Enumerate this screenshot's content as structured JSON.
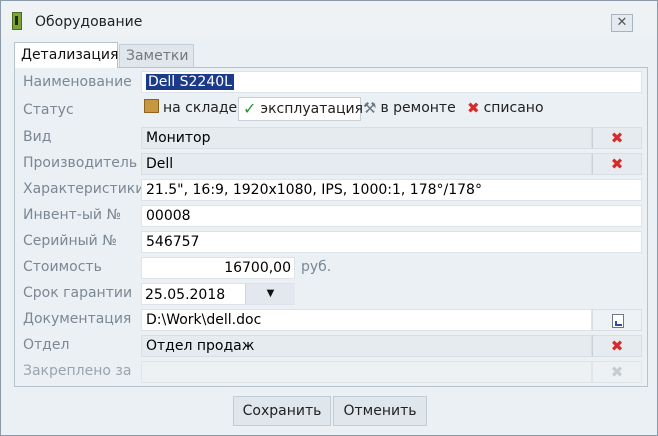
{
  "window": {
    "title": "Оборудование",
    "close_symbol": "✕"
  },
  "tabs": [
    {
      "label": "Детализация",
      "active": true
    },
    {
      "label": "Заметки",
      "active": false
    }
  ],
  "fields": {
    "name": {
      "label": "Наименование",
      "value": "Dell S2240L"
    },
    "status": {
      "label": "Статус",
      "options": [
        {
          "label": "на складе",
          "icon": "box-icon"
        },
        {
          "label": "эксплуатация",
          "icon": "check-icon"
        },
        {
          "label": "в ремонте",
          "icon": "tools-icon"
        },
        {
          "label": "списано",
          "icon": "x-icon"
        }
      ],
      "selected": "эксплуатация"
    },
    "type": {
      "label": "Вид",
      "value": "Монитор"
    },
    "manufacturer": {
      "label": "Производитель",
      "value": "Dell"
    },
    "specs": {
      "label": "Характеристики",
      "value": "21.5\", 16:9, 1920x1080, IPS, 1000:1, 178°/178°"
    },
    "inventory": {
      "label": "Инвент-ый №",
      "value": "00008"
    },
    "serial": {
      "label": "Серийный №",
      "value": "546757"
    },
    "cost": {
      "label": "Стоимость",
      "value": "16700,00",
      "unit": "руб."
    },
    "warranty": {
      "label": "Срок гарантии",
      "value": "25.05.2018",
      "arrow": "▼"
    },
    "docs": {
      "label": "Документация",
      "value": "D:\\Work\\dell.doc"
    },
    "department": {
      "label": "Отдел",
      "value": "Отдел продаж"
    },
    "assigned": {
      "label": "Закреплено за",
      "value": ""
    }
  },
  "icons": {
    "clear": "✖",
    "status_check": "✓",
    "status_tools": "⚒",
    "status_x": "✖"
  },
  "buttons": {
    "save": "Сохранить",
    "cancel": "Отменить"
  },
  "colors": {
    "accent_red": "#d42b2b",
    "check_green": "#1f9a2a",
    "selection": "#1b3a8a"
  }
}
